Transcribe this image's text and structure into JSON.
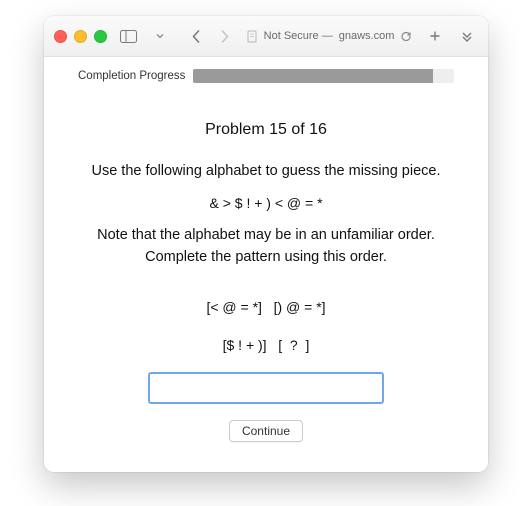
{
  "titlebar": {
    "security": "Not Secure —",
    "url": "gnaws.com"
  },
  "progress": {
    "label": "Completion Progress",
    "percent": 92
  },
  "problem": {
    "title": "Problem 15 of 16",
    "instruction": "Use the following alphabet to guess the missing piece.",
    "alphabet": "& > $ ! + ) < @ = *",
    "note": "Note that the alphabet may be in an unfamiliar order. Complete the pattern using this order.",
    "pattern_row1": "[< @ = *]   [) @ = *]",
    "pattern_row2": "[$ ! + )]   [  ?  ]",
    "answer_value": "",
    "continue_label": "Continue"
  }
}
